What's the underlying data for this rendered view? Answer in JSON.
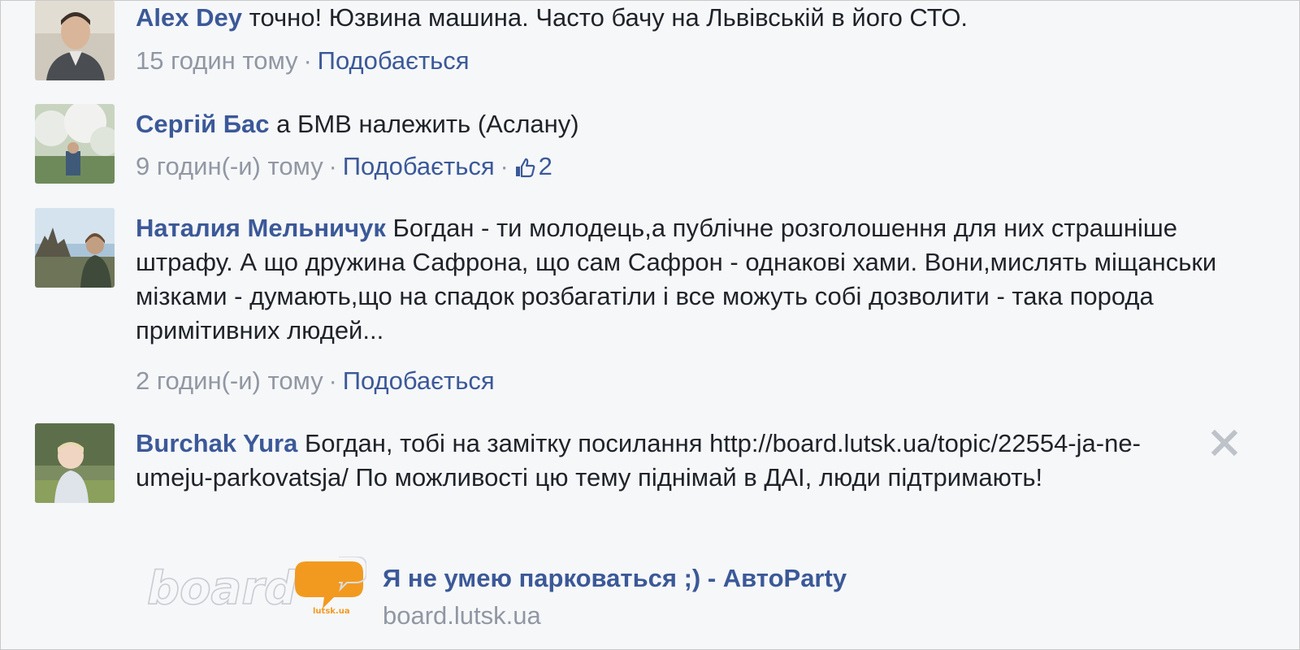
{
  "comments": [
    {
      "author": "Alex Dey",
      "text": "точно! Юзвина машина. Часто бачу на Львівській в його СТО.",
      "time": "15 годин тому",
      "like_label": "Подобається",
      "likes": ""
    },
    {
      "author": "Сергій Бас",
      "text": "а БМВ належить (Аслану)",
      "time": "9 годин(-и) тому",
      "like_label": "Подобається",
      "likes": "2"
    },
    {
      "author": "Наталия Мельничук",
      "text": "Богдан - ти молодець,а публічне розголошення для них страшніше штрафу. А що дружина Сафрона, що сам Сафрон - однакові хами. Вони,мислять міщанськи мізками - думають,що на спадок розбагатіли і все можуть собі дозволити - така порода примітивних людей...",
      "time": "2 годин(-и) тому",
      "like_label": "Подобається",
      "likes": ""
    },
    {
      "author": "Burchak Yura",
      "text": "Богдан, тобі на замітку посилання http://board.lutsk.ua/topic/22554-ja-ne-umeju-parkovatsja/ По можливості цю тему піднімай в ДАІ, люди підтримають!",
      "time": "",
      "like_label": "",
      "likes": ""
    }
  ],
  "separator": "·",
  "link_preview": {
    "logo_text": "board",
    "logo_subtext": "lutsk.ua",
    "title": "Я не умею парковаться ;) - АвтоParty",
    "domain": "board.lutsk.ua"
  },
  "icons": {
    "close": "close-icon",
    "like": "thumbs-up-icon"
  },
  "colors": {
    "link": "#3b5998",
    "meta": "#9197a3",
    "background": "#f6f7f9",
    "logo_orange": "#f29a1f"
  }
}
